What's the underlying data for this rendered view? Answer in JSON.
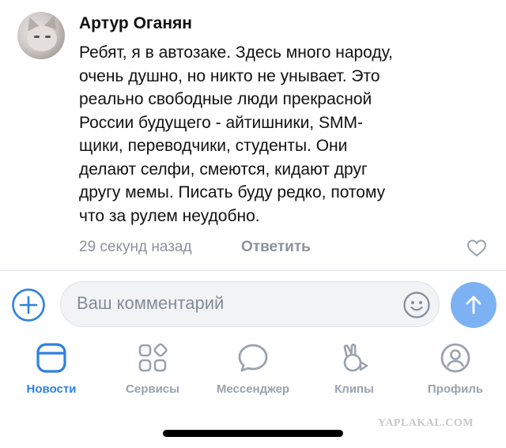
{
  "comment": {
    "author": "Артур Оганян",
    "text": "Ребят, я в автозаке. Здесь много народу, очень душно, но никто не унывает. Это реально свободные люди прекрасной России будущего - айтишники, SMM-щики, переводчики, студенты. Они делают селфи, смеются, кидают друг другу мемы. Писать буду редко, потому что за рулем неудобно.",
    "text_lines": [
      "Ребят, я в автозаке. Здесь много народу,",
      "очень душно, но никто не унывает. Это",
      "реально свободные люди прекрасной",
      "России будущего - айтишники, SMM-",
      "щики, переводчики, студенты. Они",
      "делают селфи, смеются, кидают друг",
      "другу мемы. Писать буду редко, потому",
      "что за рулем неудобно."
    ],
    "time": "29 секунд назад",
    "reply_label": "Ответить"
  },
  "composer": {
    "placeholder": "Ваш комментарий"
  },
  "tabs": [
    {
      "label": "Новости",
      "icon": "news-icon",
      "active": true
    },
    {
      "label": "Сервисы",
      "icon": "services-icon",
      "active": false
    },
    {
      "label": "Мессенджер",
      "icon": "messenger-icon",
      "active": false
    },
    {
      "label": "Клипы",
      "icon": "clips-icon",
      "active": false
    },
    {
      "label": "Профиль",
      "icon": "profile-icon",
      "active": false
    }
  ],
  "watermark": "YAPLAKAL.COM",
  "colors": {
    "accent": "#2d81e0",
    "inactive": "#99a2ad",
    "send_button": "#7cb1f3",
    "meta_text": "#8e9199"
  }
}
